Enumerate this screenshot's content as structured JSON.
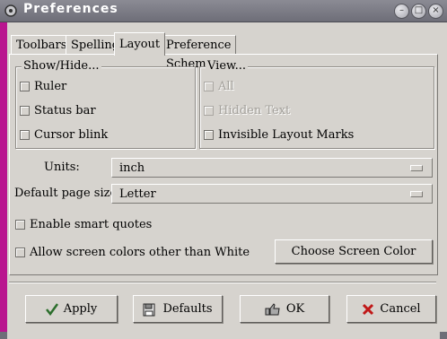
{
  "window": {
    "title": "Preferences"
  },
  "tabs": [
    {
      "label": "Toolbars"
    },
    {
      "label": "Spelling"
    },
    {
      "label": "Layout"
    },
    {
      "label": "Preference Schemes"
    }
  ],
  "show_hide": {
    "title": "Show/Hide...",
    "items": [
      {
        "label": "Ruler",
        "checked": false
      },
      {
        "label": "Status bar",
        "checked": false
      },
      {
        "label": "Cursor blink",
        "checked": false
      }
    ]
  },
  "view": {
    "title": "View...",
    "items": [
      {
        "label": "All",
        "checked": false,
        "enabled": false
      },
      {
        "label": "Hidden Text",
        "checked": false,
        "enabled": false
      },
      {
        "label": "Invisible Layout Marks",
        "checked": false,
        "enabled": true
      }
    ]
  },
  "units": {
    "label": "Units:",
    "value": "inch"
  },
  "page_size": {
    "label": "Default page size",
    "value": "Letter"
  },
  "smart_quotes": {
    "label": "Enable smart quotes",
    "checked": false
  },
  "screen_colors": {
    "label": "Allow screen colors other than White",
    "checked": false
  },
  "choose_color_button": "Choose Screen Color",
  "buttons": {
    "apply": "Apply",
    "defaults": "Defaults",
    "ok": "OK",
    "cancel": "Cancel"
  }
}
